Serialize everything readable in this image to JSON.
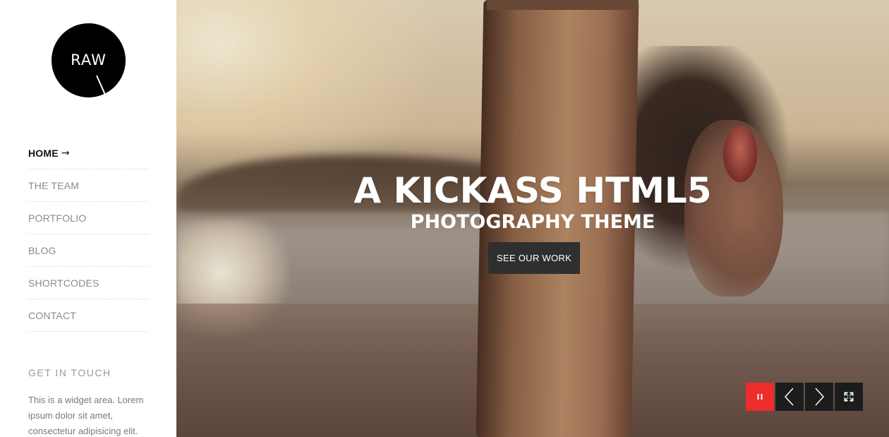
{
  "logo": {
    "text": "RAW"
  },
  "nav": {
    "items": [
      {
        "label": "HOME",
        "active": true,
        "arrow": "→"
      },
      {
        "label": "THE TEAM"
      },
      {
        "label": "PORTFOLIO"
      },
      {
        "label": "BLOG"
      },
      {
        "label": "SHORTCODES"
      },
      {
        "label": "CONTACT"
      }
    ]
  },
  "widget": {
    "title": "GET IN TOUCH",
    "body": "This is a widget area. Lorem ipsum dolor sit amet, consectetur adipisicing elit."
  },
  "hero": {
    "title": "A KICKASS HTML5",
    "subtitle": "PHOTOGRAPHY THEME",
    "button_label": "SEE OUR WORK"
  },
  "slider_controls": {
    "pause_icon": "pause-icon",
    "prev_icon": "chevron-left-icon",
    "next_icon": "chevron-right-icon",
    "fullscreen_icon": "fullscreen-icon"
  },
  "colors": {
    "accent": "#ed2c2c",
    "control_bg": "#1c1c1c",
    "button_bg": "#2f2f2f",
    "logo_bg": "#000000"
  }
}
